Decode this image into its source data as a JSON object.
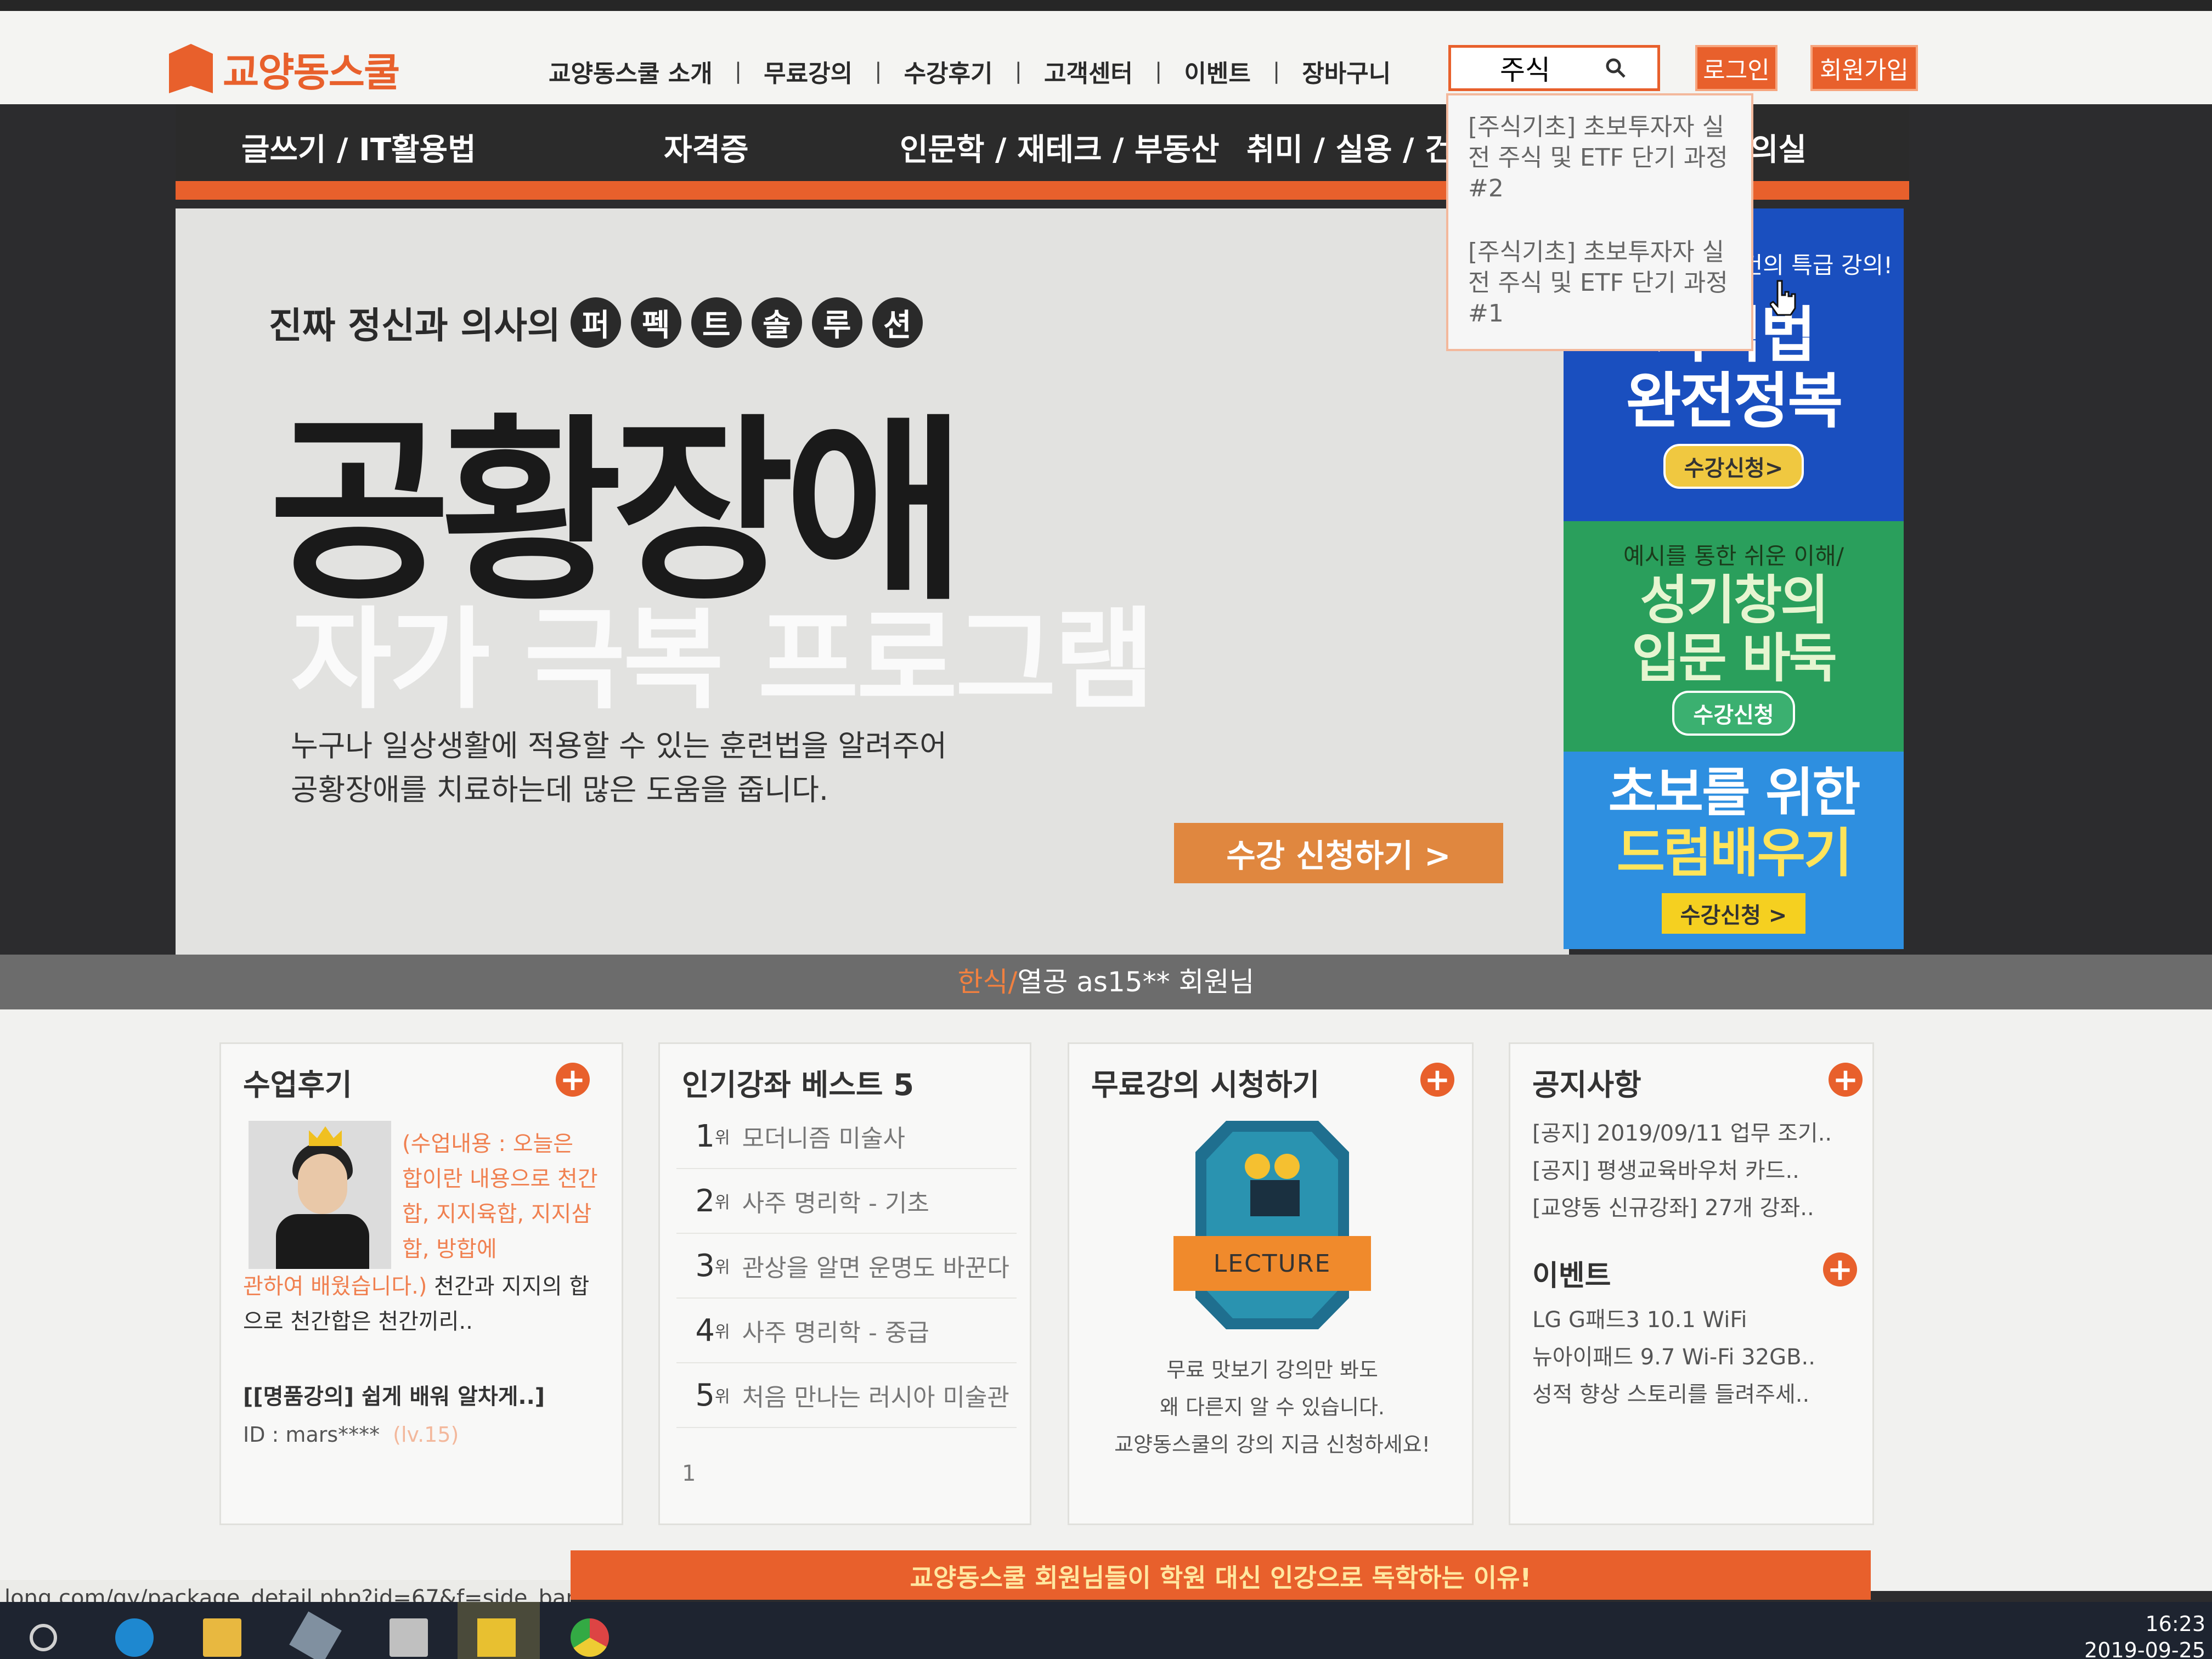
{
  "header": {
    "logo": "교양동스쿨",
    "nav": [
      "교양동스쿨 소개",
      "무료강의",
      "수강후기",
      "고객센터",
      "이벤트",
      "장바구니"
    ],
    "nav_sep": "|",
    "search_value": "주식",
    "login": "로그인",
    "join": "회원가입"
  },
  "categories": [
    "글쓰기 / IT활용법",
    "자격증",
    "인문학 / 재테크 / 부동산",
    "취미 / 실용 / 건",
    "의실"
  ],
  "autocomplete": [
    "[주식기초] 초보투자자 실전 주식 및 ETF 단기 과정 #2",
    "[주식기초] 초보투자자 실전 주식 및 ETF 단기 과정 #1"
  ],
  "hero": {
    "sub": "진짜 정신과 의사의",
    "chars": [
      "퍼",
      "펙",
      "트",
      "솔",
      "루",
      "션"
    ],
    "title": "공황장애",
    "title2": "자가 극복 프로그램",
    "desc1": "누구나 일상생활에 적용할 수 있는 훈련법을 알려주어",
    "desc2": "공황장애를 치료하는데 많은 도움을 줍니다.",
    "button": "수강 신청하기 >"
  },
  "side_banners": {
    "b1_small": "건의 특급 강의!",
    "b1_big1": "기억법",
    "b1_big2": "완전정복",
    "b1_btn": "수강신청>",
    "b2_small": "예시를 통한 쉬운 이해/",
    "b2_big1": "성기창의",
    "b2_big2": "입문 바둑",
    "b2_btn": "수강신청",
    "b3_big1": "초보를 위한",
    "b3_big2": "드럼배우기",
    "b3_btn": "수강신청 >"
  },
  "ticker": {
    "hl": "한식/",
    "text": "열공 as15** 회원님"
  },
  "review": {
    "title": "수업후기",
    "orange": "(수업내용 : 오늘은 합이란 내용으로 천간합, 지지육합, 지지삼합, 방합에",
    "orange2": "관하여 배웠습니다.)",
    "body": " 천간과 지지의 합으로 천간합은 천간끼리..",
    "lecture": "[[명품강의] 쉽게 배워 알차게..]",
    "id": "ID : mars****",
    "lv": "(lv.15)"
  },
  "best": {
    "title": "인기강좌 베스트 5",
    "unit": "위",
    "items": [
      {
        "n": "1",
        "t": "모더니즘 미술사"
      },
      {
        "n": "2",
        "t": "사주 명리학 - 기초"
      },
      {
        "n": "3",
        "t": "관상을 알면 운명도 바꾼다"
      },
      {
        "n": "4",
        "t": "사주 명리학 - 중급"
      },
      {
        "n": "5",
        "t": "처음 만나는 러시아 미술관"
      }
    ],
    "page": "1"
  },
  "free": {
    "title": "무료강의 시청하기",
    "badge": "LECTURE",
    "text1": "무료 맛보기 강의만 봐도",
    "text2": "왜 다른지 알 수 있습니다.",
    "text3": "교양동스쿨의 강의 지금 신청하세요!"
  },
  "notice": {
    "title": "공지사항",
    "items": [
      "[공지] 2019/09/11 업무 조기..",
      "[공지] 평생교육바우처 카드..",
      "[교양동 신규강좌] 27개 강좌.."
    ],
    "event_title": "이벤트",
    "events": [
      "LG G패드3 10.1 WiFi",
      "뉴아이패드 9.7 Wi-Fi 32GB..",
      "성적 향상 스토리를 들려주세.."
    ]
  },
  "bottom_banner": "교양동스쿨 회원님들이 학원 대신 인강으로 독학하는 이유!",
  "status_url": "long.com/gy/package_detail.php?id=67&f=side_banner9",
  "clock": {
    "time": "16:23",
    "date": "2019-09-25"
  },
  "colors": {
    "accent": "#e8602c",
    "dark": "#2b2b2b",
    "blue": "#1a4fbf",
    "green": "#2a9f5c"
  }
}
